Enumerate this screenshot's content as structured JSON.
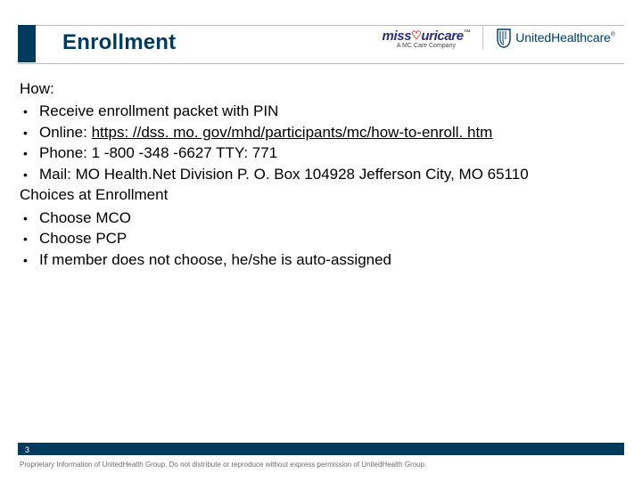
{
  "title": "Enrollment",
  "logos": {
    "missouricare": {
      "line1_a": "miss",
      "line1_b": "uricare",
      "tm": "™",
      "sub": "A MC Care Company"
    },
    "uhc": {
      "text": "UnitedHealthcare",
      "reg": "®"
    }
  },
  "sections": [
    {
      "heading": "How:",
      "bullets": [
        {
          "text": "Receive enrollment packet with PIN"
        },
        {
          "prefix": "Online: ",
          "link": "https: //dss. mo. gov/mhd/participants/mc/how-to-enroll. htm"
        },
        {
          "text": "Phone: 1 -800 -348 -6627 TTY: 771"
        },
        {
          "text": "Mail: MO Health.Net Division P. O. Box 104928 Jefferson City, MO 65110"
        }
      ]
    },
    {
      "heading": "Choices at Enrollment",
      "bullets": [
        {
          "text": "Choose MCO"
        },
        {
          "text": "Choose PCP"
        },
        {
          "text": "If member does not choose, he/she is auto-assigned"
        }
      ]
    }
  ],
  "page_number": "3",
  "footer": "Proprietary Information of UnitedHealth Group.  Do not distribute or reproduce without express permission of UnitedHealth Group."
}
